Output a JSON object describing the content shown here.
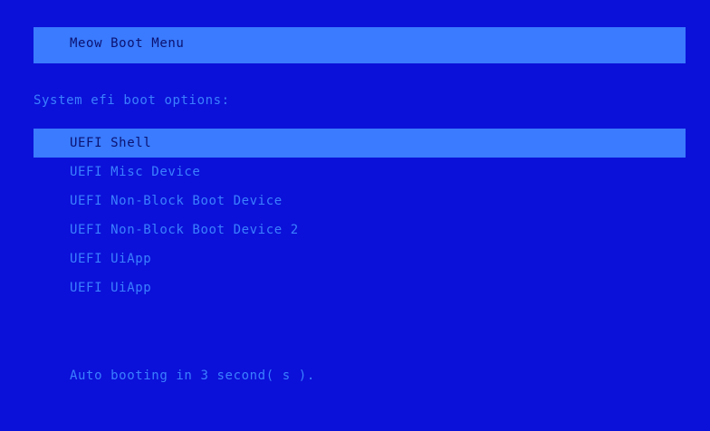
{
  "header": {
    "title": "Meow Boot Menu"
  },
  "section": {
    "label": "System efi boot options:"
  },
  "boot_options": [
    {
      "label": "UEFI Shell",
      "selected": true
    },
    {
      "label": "UEFI Misc Device",
      "selected": false
    },
    {
      "label": "UEFI Non-Block Boot Device",
      "selected": false
    },
    {
      "label": "UEFI Non-Block Boot Device 2",
      "selected": false
    },
    {
      "label": "UEFI UiApp",
      "selected": false
    },
    {
      "label": "UEFI UiApp",
      "selected": false
    }
  ],
  "status": {
    "text": "Auto booting in 3 second( s )."
  },
  "colors": {
    "background": "#0b11d8",
    "highlight": "#3a7bff",
    "text": "#3b80ff",
    "highlight_text": "#0b1270"
  }
}
